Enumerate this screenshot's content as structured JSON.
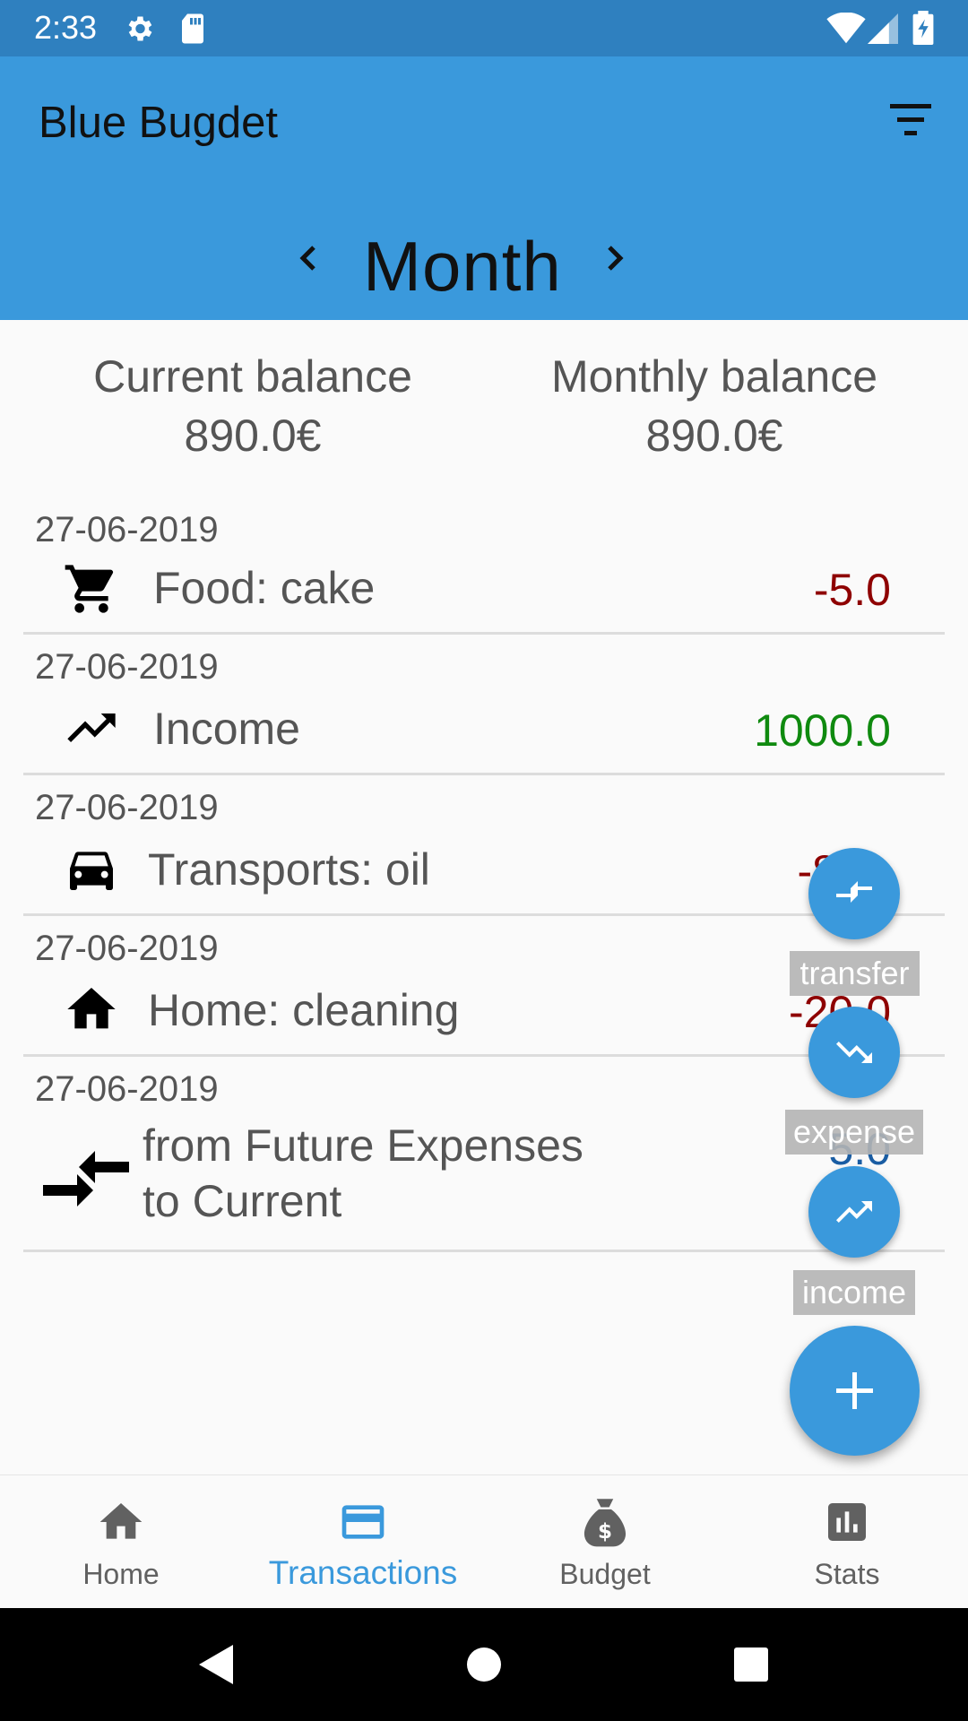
{
  "status_bar": {
    "time": "2:33"
  },
  "app_bar": {
    "title": "Blue Bugdet",
    "period": "Month"
  },
  "balances": {
    "current_label": "Current balance",
    "current_value": "890.0€",
    "monthly_label": "Monthly balance",
    "monthly_value": "890.0€"
  },
  "transactions": [
    {
      "date": "27-06-2019",
      "icon": "shopping-cart-icon",
      "text": "Food: cake",
      "amount": "-5.0"
    },
    {
      "date": "27-06-2019",
      "icon": "trending-up-icon",
      "text": "Income",
      "amount": "1000.0"
    },
    {
      "date": "27-06-2019",
      "icon": "car-icon",
      "text": "Transports: oil",
      "amount": "-8"
    },
    {
      "date": "27-06-2019",
      "icon": "home-icon",
      "text": "Home: cleaning",
      "amount": "-20.0"
    },
    {
      "date": "27-06-2019",
      "icon": "transfer-icon",
      "text_line1": "from Future Expenses",
      "text_line2": "to Current",
      "amount": "5.0"
    }
  ],
  "fab_menu": {
    "transfer_label": "transfer",
    "expense_label": "expense",
    "income_label": "income"
  },
  "bottom_nav": {
    "items": [
      {
        "label": "Home",
        "icon": "home-icon"
      },
      {
        "label": "Transactions",
        "icon": "credit-card-icon",
        "active": true
      },
      {
        "label": "Budget",
        "icon": "money-bag-icon"
      },
      {
        "label": "Stats",
        "icon": "bar-chart-icon"
      }
    ]
  },
  "colors": {
    "primary": "#3a99dc",
    "status_bar": "#2f80bf",
    "negative": "#8e0000",
    "positive": "#0f8a0f"
  }
}
